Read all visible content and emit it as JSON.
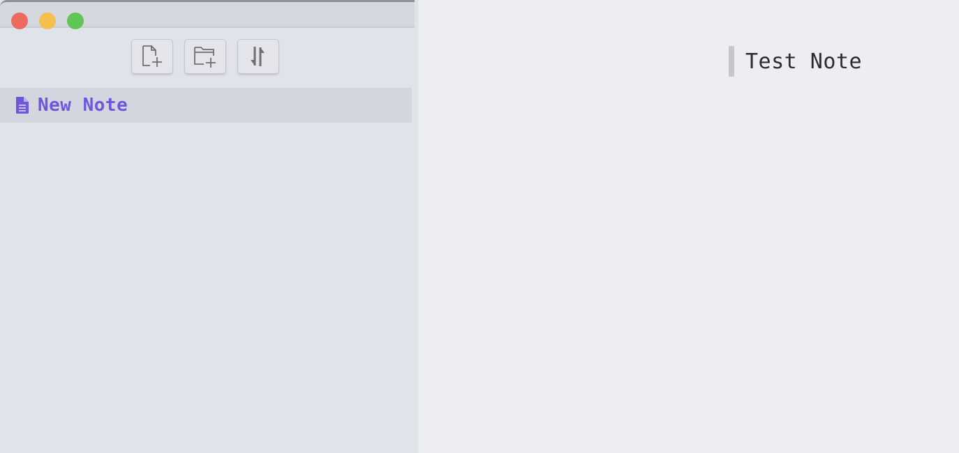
{
  "sidebar": {
    "toolbar": {
      "new_note_icon": "new-file-icon",
      "new_folder_icon": "new-folder-icon",
      "sort_icon": "sort-icon"
    },
    "notes": [
      {
        "title": "New Note",
        "icon": "document-icon"
      }
    ]
  },
  "editor": {
    "heading": "Test Note"
  },
  "colors": {
    "accent": "#6f57dc",
    "traffic_close": "#ec6a5e",
    "traffic_minimize": "#f4bf4f",
    "traffic_maximize": "#61c554"
  }
}
